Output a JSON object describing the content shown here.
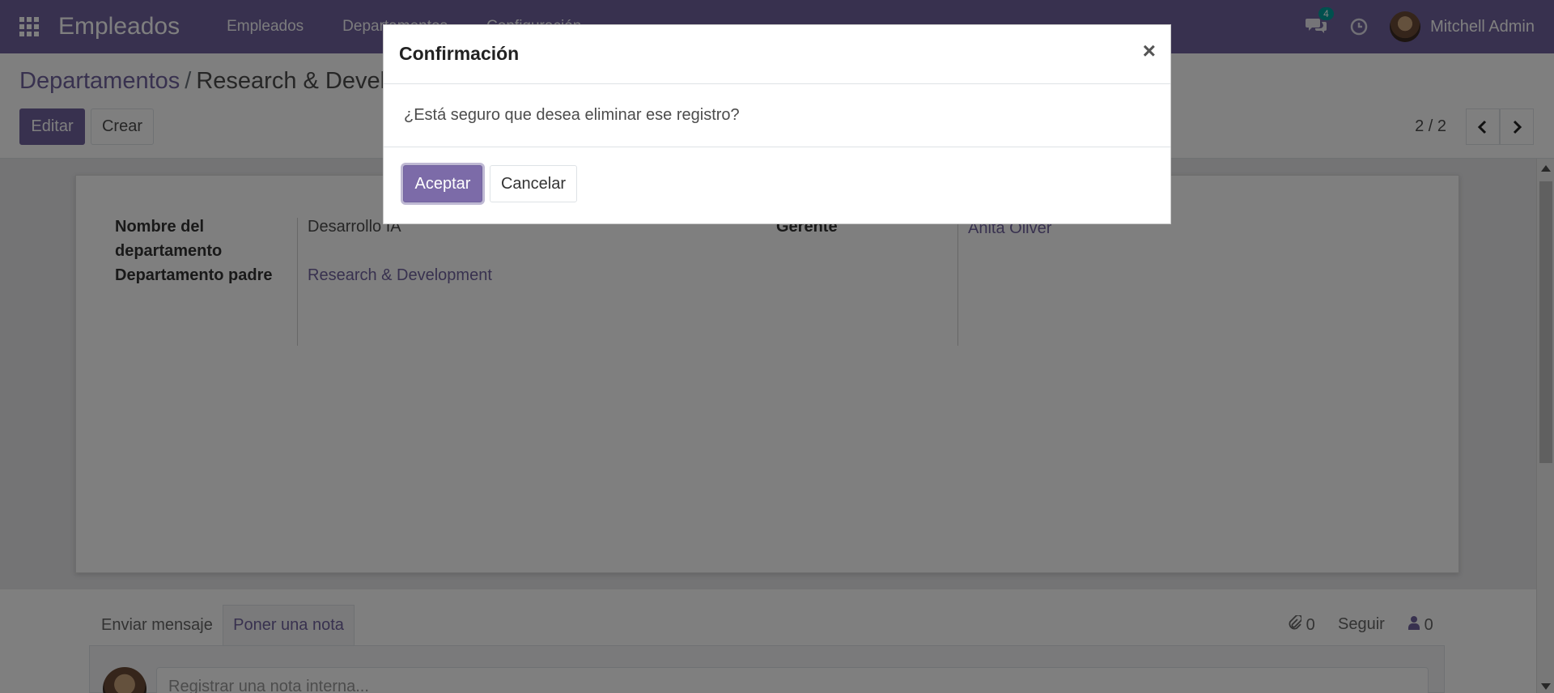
{
  "navbar": {
    "app_name": "Empleados",
    "menu": [
      "Empleados",
      "Departamentos",
      "Configuración"
    ],
    "chat_badge": "4",
    "user_name": "Mitchell Admin"
  },
  "breadcrumb": {
    "parent": "Departamentos",
    "separator": "/",
    "current": "Research & Develop"
  },
  "toolbar": {
    "edit_label": "Editar",
    "create_label": "Crear",
    "pager_text": "2 / 2",
    "prev_icon": "‹",
    "next_icon": "›"
  },
  "form": {
    "name_label_line1": "Nombre del",
    "name_label_line2": "departamento",
    "name_value": "Desarrollo IA",
    "parent_label": "Departamento padre",
    "parent_value": "Research & Development",
    "manager_label": "Gerente",
    "manager_value": "Anita Oliver"
  },
  "chatter": {
    "send_message": "Enviar mensaje",
    "log_note": "Poner una nota",
    "attachments_count": "0",
    "follow": "Seguir",
    "followers_count": "0",
    "note_placeholder": "Registrar una nota interna..."
  },
  "modal": {
    "title": "Confirmación",
    "close": "×",
    "message": "¿Está seguro que desea eliminar ese registro?",
    "accept": "Aceptar",
    "cancel": "Cancelar"
  },
  "colors": {
    "brand": "#71639e",
    "badge": "#00a09d"
  }
}
